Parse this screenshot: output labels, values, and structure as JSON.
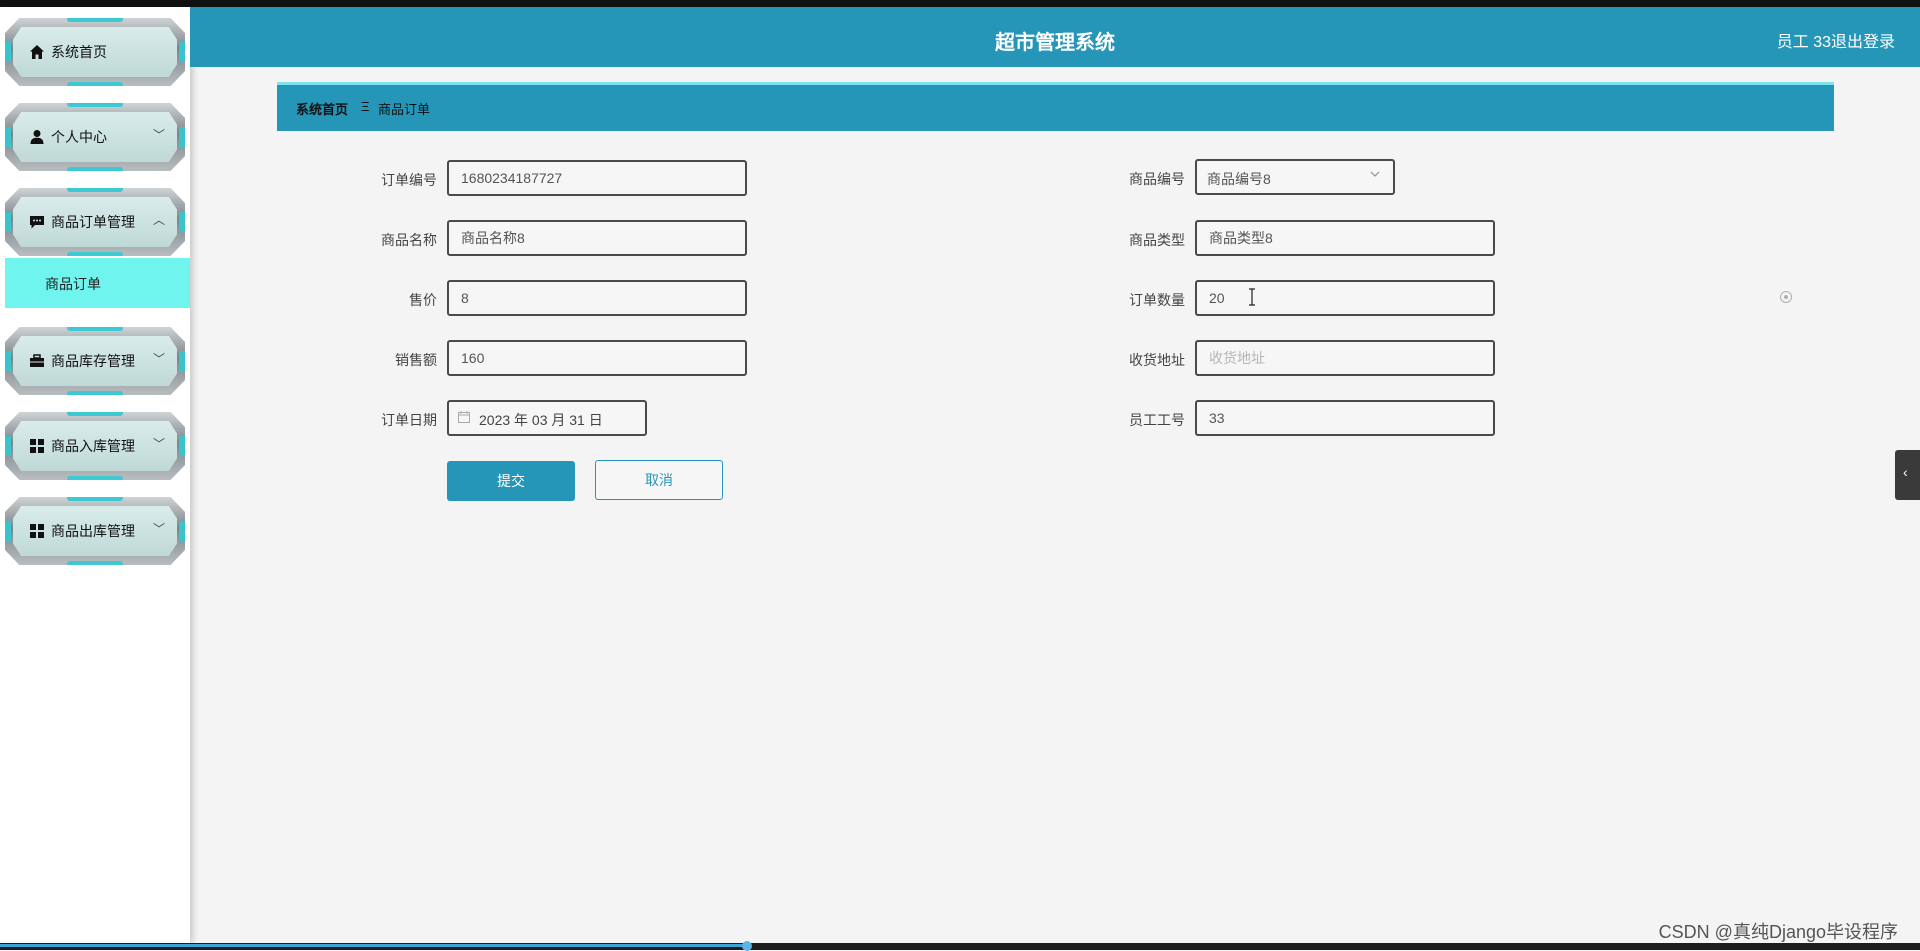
{
  "header": {
    "title": "超市管理系统",
    "user": "员工 33",
    "logout": "退出登录",
    "color": "#2596b8"
  },
  "sidebar": {
    "items": [
      {
        "label": "系统首页",
        "icon": "home-icon"
      },
      {
        "label": "个人中心",
        "icon": "user-icon",
        "chevron": "﹀"
      },
      {
        "label": "商品订单管理",
        "icon": "chat-icon",
        "chevron": "︿"
      },
      {
        "label": "商品库存管理",
        "icon": "briefcase-icon",
        "chevron": "﹀"
      },
      {
        "label": "商品入库管理",
        "icon": "grid-icon",
        "chevron": "﹀"
      },
      {
        "label": "商品出库管理",
        "icon": "grid-icon",
        "chevron": "﹀"
      }
    ],
    "active_sub": "商品订单",
    "active_color": "#6ff5ee"
  },
  "breadcrumb": {
    "home": "系统首页",
    "separator": "Ξ",
    "current": "商品订单"
  },
  "form": {
    "order_no": {
      "label": "订单编号",
      "value": "1680234187727"
    },
    "product_no": {
      "label": "商品编号",
      "value": "商品编号8"
    },
    "product_name": {
      "label": "商品名称",
      "value": "商品名称8"
    },
    "product_type": {
      "label": "商品类型",
      "value": "商品类型8"
    },
    "price": {
      "label": "售价",
      "value": "8"
    },
    "quantity": {
      "label": "订单数量",
      "value": "20"
    },
    "sales": {
      "label": "销售额",
      "value": "160"
    },
    "address": {
      "label": "收货地址",
      "value": "",
      "placeholder": "收货地址"
    },
    "order_date": {
      "label": "订单日期",
      "value": "2023 年 03 月 31 日"
    },
    "employee_no": {
      "label": "员工工号",
      "value": "33"
    }
  },
  "buttons": {
    "submit": "提交",
    "cancel": "取消"
  },
  "side_toggle": "‹",
  "watermark": "CSDN @真纯Django毕设程序"
}
